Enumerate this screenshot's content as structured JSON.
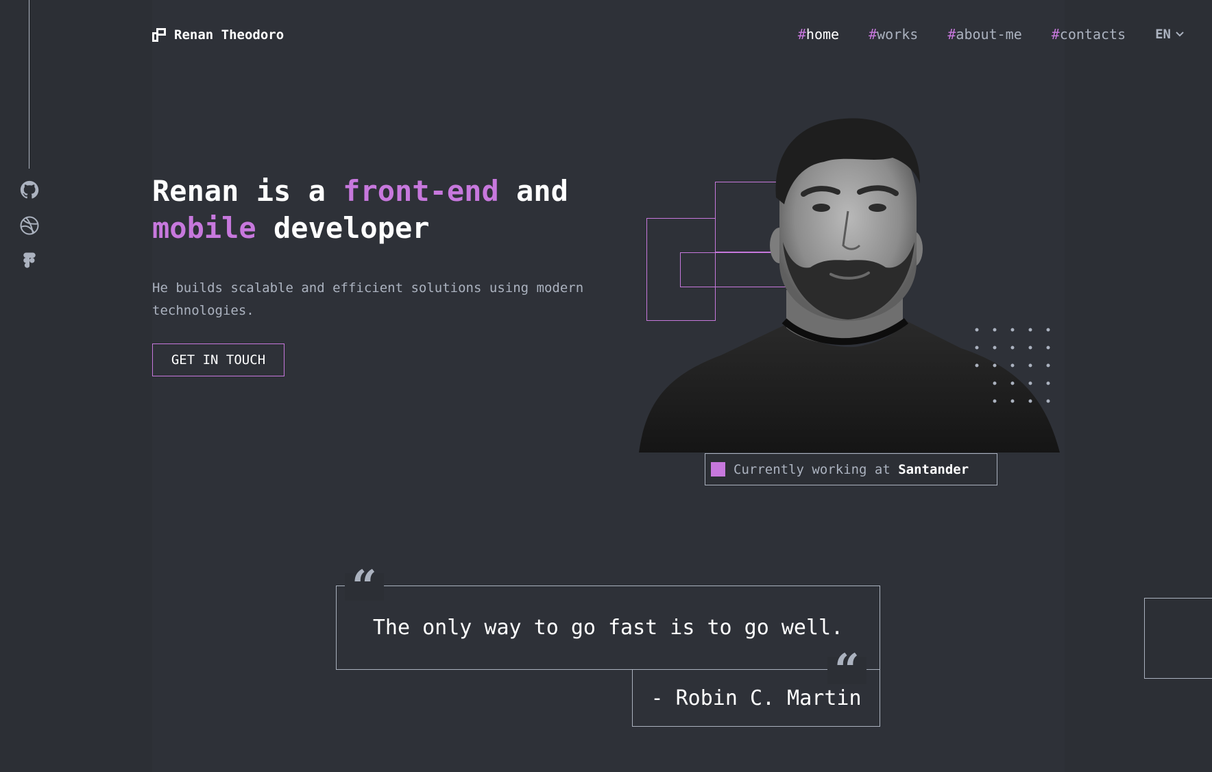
{
  "header": {
    "logo_text": "Renan Theodoro",
    "nav": [
      {
        "hash": "#",
        "label": "home",
        "active": true
      },
      {
        "hash": "#",
        "label": "works",
        "active": false
      },
      {
        "hash": "#",
        "label": "about-me",
        "active": false
      },
      {
        "hash": "#",
        "label": "contacts",
        "active": false
      }
    ],
    "language": "EN"
  },
  "social": [
    "github-icon",
    "dribbble-icon",
    "figma-icon"
  ],
  "hero": {
    "title_part1": "Renan is a ",
    "title_accent1": "front-end",
    "title_part2": " and",
    "title_accent2": "mobile",
    "title_part3": " developer",
    "subtitle": "He builds scalable and efficient solutions using modern technologies.",
    "cta_label": "GET IN TOUCH"
  },
  "status": {
    "prefix": "Currently working at ",
    "company": "Santander"
  },
  "quote": {
    "text": "The only way to go fast is to go well.",
    "author": "- Robin C. Martin"
  },
  "colors": {
    "background": "#2c2f35",
    "accent": "#c778dd",
    "text_gray": "#abb2bf",
    "white": "#ffffff"
  }
}
